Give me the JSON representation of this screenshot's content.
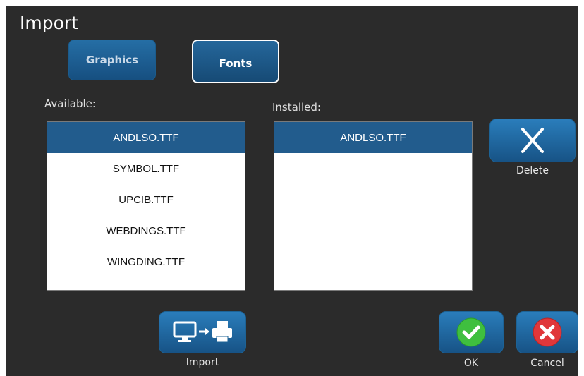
{
  "title": "Import",
  "tabs": {
    "graphics": "Graphics",
    "fonts": "Fonts"
  },
  "available": {
    "label": "Available:",
    "items": [
      "ANDLSO.TTF",
      "SYMBOL.TTF",
      "UPCIB.TTF",
      "WEBDINGS.TTF",
      "WINGDING.TTF"
    ],
    "selected_index": 0
  },
  "installed": {
    "label": "Installed:",
    "items": [
      "ANDLSO.TTF"
    ],
    "selected_index": 0
  },
  "buttons": {
    "delete": "Delete",
    "import": "Import",
    "ok": "OK",
    "cancel": "Cancel"
  },
  "colors": {
    "selection": "#225c8d",
    "ok": "#3fbf3f",
    "cancel": "#e0373a"
  }
}
